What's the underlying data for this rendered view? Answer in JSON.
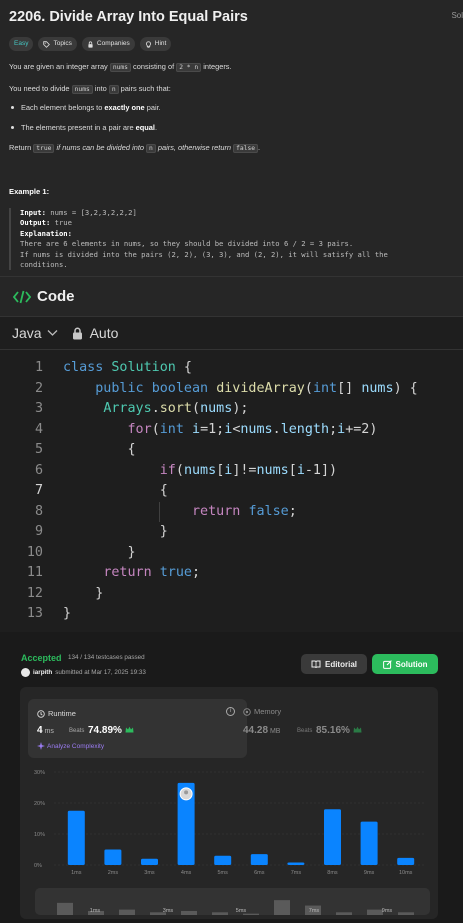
{
  "problem": {
    "title": "2206. Divide Array Into Equal Pairs",
    "side_tab": "Sol",
    "tags": [
      {
        "label": "Easy",
        "icon": ""
      },
      {
        "label": "Topics",
        "icon": "tag-icon"
      },
      {
        "label": "Companies",
        "icon": "lock-icon"
      },
      {
        "label": "Hint",
        "icon": "lightbulb-icon"
      }
    ],
    "para1": {
      "a": "You are given an integer array ",
      "code1": "nums",
      "b": " consisting of ",
      "code2": "2 * n",
      "c": " integers."
    },
    "para2": {
      "a": "You need to divide ",
      "code1": "nums",
      "b": " into ",
      "code2": "n",
      "c": " pairs such that:"
    },
    "bullets": [
      {
        "a": "Each element belongs to ",
        "bold": "exactly one",
        "c": " pair."
      },
      {
        "a": "The elements present in a pair are ",
        "bold": "equal",
        "c": "."
      }
    ],
    "para3": {
      "a": "Return ",
      "code1": "true",
      "b": " if nums can be divided into ",
      "code2": "n",
      "c": " pairs, otherwise return ",
      "code3": "false",
      "d": "."
    },
    "example_title": "Example 1:",
    "example": {
      "input_label": "Input:",
      "input_value": " nums = [3,2,3,2,2,2]",
      "output_label": "Output:",
      "output_value": " true",
      "explanation_label": "Explanation:",
      "explanation_lines": [
        "There are 6 elements in nums, so they should be divided into 6 / 2 = 3 pairs.",
        "If nums is divided into the pairs (2, 2), (3, 3), and (2, 2), it will satisfy all the",
        "conditions."
      ]
    }
  },
  "code_section": {
    "title": "Code",
    "language": "Java",
    "mode": "Auto",
    "current_line": 7,
    "lines": [
      [
        [
          "kw",
          "class"
        ],
        [
          "tx",
          " "
        ],
        [
          "ty",
          "Solution"
        ],
        [
          "tx",
          " {"
        ]
      ],
      [
        [
          "tx",
          "    "
        ],
        [
          "kw",
          "public"
        ],
        [
          "tx",
          " "
        ],
        [
          "kw",
          "boolean"
        ],
        [
          "tx",
          " "
        ],
        [
          "fn",
          "divideArray"
        ],
        [
          "tx",
          "("
        ],
        [
          "kw",
          "int"
        ],
        [
          "tx",
          "[] "
        ],
        [
          "id",
          "nums"
        ],
        [
          "tx",
          ") {"
        ]
      ],
      [
        [
          "tx",
          "     "
        ],
        [
          "ty",
          "Arrays"
        ],
        [
          "tx",
          "."
        ],
        [
          "fn",
          "sort"
        ],
        [
          "tx",
          "("
        ],
        [
          "id",
          "nums"
        ],
        [
          "tx",
          ");"
        ]
      ],
      [
        [
          "tx",
          "        "
        ],
        [
          "ctl",
          "for"
        ],
        [
          "tx",
          "("
        ],
        [
          "kw",
          "int"
        ],
        [
          "tx",
          " "
        ],
        [
          "id",
          "i"
        ],
        [
          "tx",
          "=1;"
        ],
        [
          "id",
          "i"
        ],
        [
          "tx",
          "<"
        ],
        [
          "id",
          "nums"
        ],
        [
          "tx",
          "."
        ],
        [
          "id",
          "length"
        ],
        [
          "tx",
          ";"
        ],
        [
          "id",
          "i"
        ],
        [
          "tx",
          "+=2)"
        ]
      ],
      [
        [
          "tx",
          "        {"
        ]
      ],
      [
        [
          "tx",
          "            "
        ],
        [
          "ctl",
          "if"
        ],
        [
          "tx",
          "("
        ],
        [
          "id",
          "nums"
        ],
        [
          "tx",
          "["
        ],
        [
          "id",
          "i"
        ],
        [
          "tx",
          "]!="
        ],
        [
          "id",
          "nums"
        ],
        [
          "tx",
          "["
        ],
        [
          "id",
          "i"
        ],
        [
          "tx",
          "-1])"
        ]
      ],
      [
        [
          "tx",
          "            {"
        ]
      ],
      [
        [
          "tx",
          "                "
        ],
        [
          "ctl",
          "return"
        ],
        [
          "tx",
          " "
        ],
        [
          "kw",
          "false"
        ],
        [
          "tx",
          ";"
        ]
      ],
      [
        [
          "tx",
          "            }"
        ]
      ],
      [
        [
          "tx",
          "        }"
        ]
      ],
      [
        [
          "tx",
          "     "
        ],
        [
          "ctl",
          "return"
        ],
        [
          "tx",
          " "
        ],
        [
          "kw",
          "true"
        ],
        [
          "tx",
          ";"
        ]
      ],
      [
        [
          "tx",
          "    }"
        ]
      ],
      [
        [
          "tx",
          "}"
        ]
      ]
    ]
  },
  "submission": {
    "status": "Accepted",
    "testcases": "134 / 134 testcases passed",
    "user": "iarpith",
    "submitted_at": "submitted at Mar 17, 2025 19:33",
    "editorial_label": "Editorial",
    "solution_label": "Solution",
    "runtime": {
      "title": "Runtime",
      "value": "4",
      "unit": " ms",
      "beats_label": "Beats",
      "beats_value": "74.89%",
      "analyze_label": "Analyze Complexity"
    },
    "memory": {
      "title": "Memory",
      "value": "44.28",
      "unit": " MB",
      "beats_label": "Beats",
      "beats_value": "85.16%"
    },
    "colors": {
      "accent_green": "#2cbb5d",
      "bar_blue": "#0a84ff",
      "easy_teal": "#46c6c2"
    }
  },
  "chart_data": {
    "type": "bar",
    "categories": [
      "1ms",
      "2ms",
      "3ms",
      "4ms",
      "5ms",
      "6ms",
      "7ms",
      "8ms",
      "9ms",
      "10ms"
    ],
    "values": [
      17.5,
      5.0,
      2.0,
      26.5,
      3.0,
      3.5,
      0.8,
      18.0,
      14.0,
      2.3
    ],
    "ylim": [
      0,
      30
    ],
    "yticks": [
      "0%",
      "10%",
      "20%",
      "30%"
    ],
    "highlight_category": "4ms",
    "minimap_labels": [
      "1ms",
      "3ms",
      "5ms",
      "7ms",
      "9ms"
    ]
  }
}
